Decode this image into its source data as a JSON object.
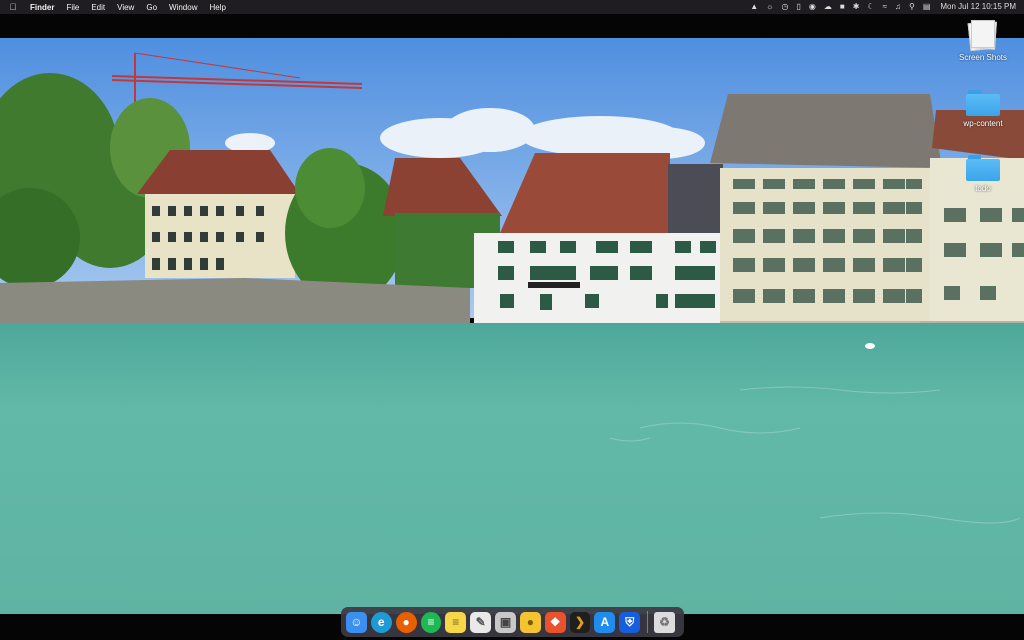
{
  "menubar": {
    "app_name": "Finder",
    "menus": [
      "File",
      "Edit",
      "View",
      "Go",
      "Window",
      "Help"
    ],
    "status_icons": [
      "dropbox-icon",
      "flame-icon",
      "clock-sync-icon",
      "battery-icon",
      "power-icon",
      "cloud-icon",
      "user-icon",
      "bluetooth-icon",
      "moon-icon",
      "wifi-icon",
      "volume-icon",
      "search-icon",
      "control-center-icon"
    ],
    "clock": "Mon Jul 12  10:15 PM"
  },
  "desktop": {
    "icons": [
      {
        "label": "Screen Shots",
        "icon": "screenshots-stack-icon"
      },
      {
        "label": "wp-content",
        "icon": "folder-icon"
      },
      {
        "label": "todo",
        "icon": "folder-icon"
      }
    ]
  },
  "dock": {
    "apps": [
      {
        "name": "Finder",
        "icon": "finder-icon",
        "color": "#3b8ff0"
      },
      {
        "name": "Microsoft Edge",
        "icon": "edge-icon",
        "color": "#1e9bd7"
      },
      {
        "name": "Firefox",
        "icon": "firefox-icon",
        "color": "#e66000"
      },
      {
        "name": "Spotify",
        "icon": "spotify-icon",
        "color": "#1db954"
      },
      {
        "name": "Notes",
        "icon": "notes-icon",
        "color": "#f7d74a"
      },
      {
        "name": "TextEdit",
        "icon": "textedit-icon",
        "color": "#e9e9e9"
      },
      {
        "name": "Preview",
        "icon": "preview-icon",
        "color": "#c8c8c8"
      },
      {
        "name": "Cyberduck",
        "icon": "cyberduck-icon",
        "color": "#f4c430"
      },
      {
        "name": "Tower",
        "icon": "git-client-icon",
        "color": "#e8532d"
      },
      {
        "name": "Plex",
        "icon": "plex-icon",
        "color": "#1f1f1f"
      },
      {
        "name": "App Store",
        "icon": "app-store-icon",
        "color": "#1f8cf0"
      },
      {
        "name": "Bitwarden",
        "icon": "bitwarden-icon",
        "color": "#175ddc"
      }
    ],
    "trash": {
      "name": "Trash",
      "icon": "trash-icon"
    }
  }
}
